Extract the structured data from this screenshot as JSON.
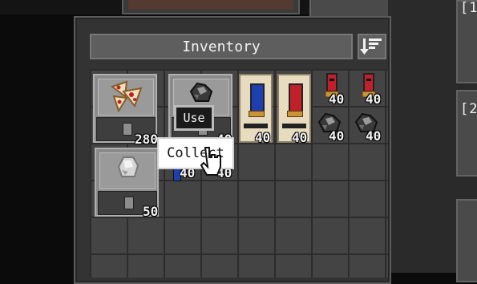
{
  "inventory": {
    "title": "Inventory",
    "sort_icon": "sort-descending-icon",
    "slots": [
      {
        "item": "pizza-crate",
        "icon": "pizza-icon",
        "quantity": "280"
      },
      {
        "item": "coal-crate",
        "icon": "coal-ore-icon",
        "quantity": "40"
      },
      {
        "item": "blue-shotgun-shell",
        "icon": "blue-shell-icon",
        "quantity": "40"
      },
      {
        "item": "red-shotgun-shell",
        "icon": "red-shell-icon",
        "quantity": "40"
      },
      {
        "item": "red-shell",
        "icon": "red-shell-icon",
        "quantity": "40"
      },
      {
        "item": "red-shell",
        "icon": "red-shell-icon",
        "quantity": "40"
      },
      {
        "item": "coal-ore",
        "icon": "coal-ore-icon",
        "quantity": "40"
      },
      {
        "item": "coal-ore",
        "icon": "coal-ore-icon",
        "quantity": "40"
      },
      {
        "item": "silver-ore-crate",
        "icon": "silver-ore-icon",
        "quantity": "50"
      },
      {
        "item": "hidden-item",
        "icon": "blue-item-icon",
        "quantity": "40"
      },
      {
        "item": "hidden-item",
        "icon": "coal-ore-icon",
        "quantity": "40"
      }
    ]
  },
  "context_menu": {
    "use_label": "Use",
    "collect_label": "Collect"
  },
  "side_labels": {
    "top": "[1",
    "middle": "[2"
  },
  "colors": {
    "panel": "#333333",
    "slot_bg": "#444444",
    "shell_blue": "#1e3fb0",
    "shell_red": "#c0202a",
    "cap_brass": "#c89436"
  }
}
